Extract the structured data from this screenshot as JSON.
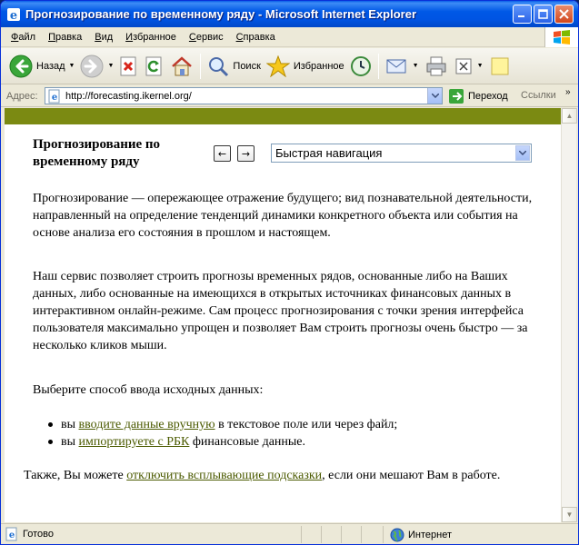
{
  "window": {
    "title": "Прогнозирование по временному ряду - Microsoft Internet Explorer"
  },
  "menu": {
    "items": [
      {
        "u": "Ф",
        "rest": "айл"
      },
      {
        "u": "П",
        "rest": "равка"
      },
      {
        "u": "В",
        "rest": "ид"
      },
      {
        "u": "И",
        "rest": "збранное"
      },
      {
        "u": "С",
        "rest": "ервис"
      },
      {
        "u": "С",
        "rest": "правка"
      }
    ]
  },
  "toolbar": {
    "back_label": "Назад",
    "search_label": "Поиск",
    "favorites_label": "Избранное"
  },
  "address": {
    "label": "Адрес:",
    "url": "http://forecasting.ikernel.org/",
    "go_label": "Переход",
    "links_label": "Ссылки"
  },
  "page": {
    "title": "Прогнозирование по временному ряду",
    "prev_arrow": "←",
    "next_arrow": "→",
    "quicknav": "Быстрая навигация",
    "para1": "Прогнозирование — опережающее отражение будущего; вид познавательной деятельности, направленный на определение тенденций динамики конкретного объекта или события на основе анализа его состояния в прошлом и настоящем.",
    "para2": "Наш сервис позволяет строить прогнозы временных рядов, основанные либо на Ваших данных, либо основанные на имеющихся в открытых источниках финансовых данных в интерактивном онлайн-режиме. Сам процесс прогнозирования с точки зрения интерфейса пользователя максимально упрощен и позволяет Вам строить прогнозы очень быстро — за несколько кликов мыши.",
    "choose": "Выберите способ ввода исходных данных:",
    "bullet1": {
      "pre": "вы ",
      "link": "вводите данные вручную",
      "post": " в текстовое поле или через файл;"
    },
    "bullet2": {
      "pre": "вы ",
      "link": "импортируете с РБК",
      "post": " финансовые данные."
    },
    "footer": {
      "pre": "Также, Вы можете ",
      "link": "отключить всплывающие подсказки",
      "post": ", если они мешают Вам в работе."
    }
  },
  "status": {
    "text": "Готово",
    "zone": "Интернет"
  },
  "colors": {
    "accent_band": "#7b8a12",
    "link": "#4b5a00",
    "titlebar": "#0054e3"
  }
}
